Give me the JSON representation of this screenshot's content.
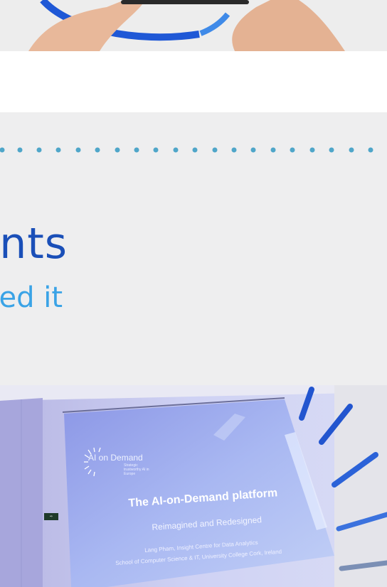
{
  "section": {
    "heading_fragment": "nts",
    "subheading_fragment": "ed it"
  },
  "slide": {
    "logo_text": "AI on Demand",
    "logo_sub": "Strategic trustworthy AI in Europe",
    "title": "The AI-on-Demand platform",
    "subtitle": "Reimagined and Redesigned",
    "author_line1": "Lang Pham, Insight Centre for Data Analytics",
    "author_line2": "School of Computer Science & IT, University College Cork, Ireland"
  },
  "colors": {
    "heading": "#1a4fb8",
    "subheading": "#3aa3e6",
    "dots": "#4fa6c9",
    "accent_blue": "#1f58d6"
  }
}
